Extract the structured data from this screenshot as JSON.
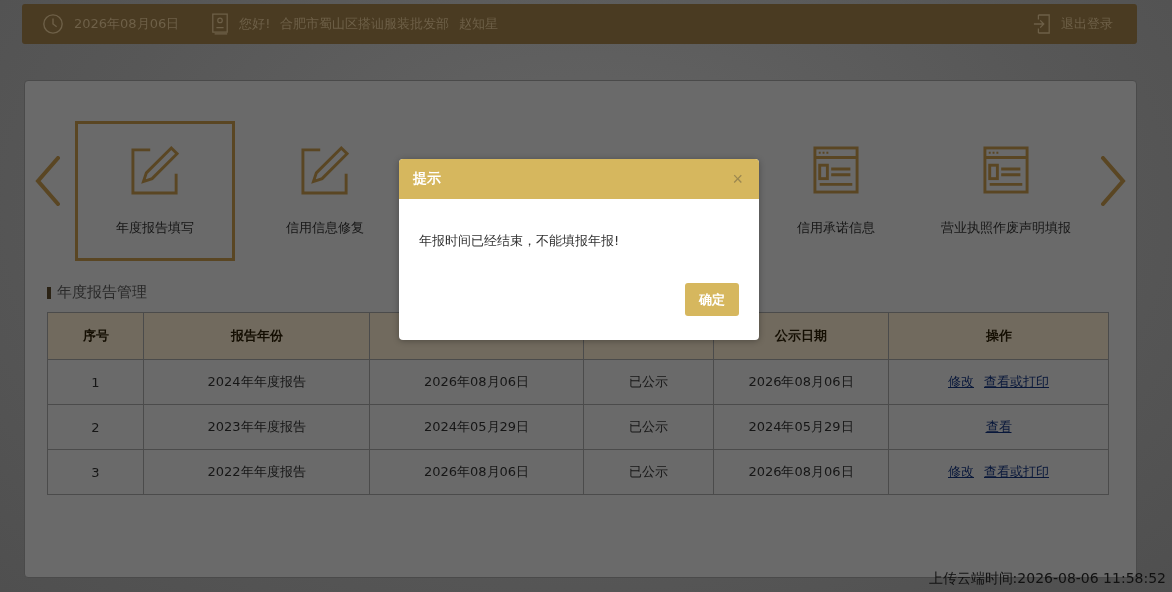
{
  "header": {
    "date": "2026年08月06日",
    "greeting": "您好!",
    "company": "合肥市蜀山区搭讪服装批发部",
    "user": "赵知星",
    "logout": "退出登录"
  },
  "nav": {
    "items": [
      {
        "label": "年度报告填写",
        "kind": "edit",
        "selected": true
      },
      {
        "label": "信用信息修复",
        "kind": "edit",
        "selected": false
      },
      {
        "label": "信用承诺信息",
        "kind": "form",
        "selected": false
      },
      {
        "label": "营业执照作废声明填报",
        "kind": "form",
        "selected": false
      }
    ]
  },
  "section_title": "年度报告管理",
  "table": {
    "columns": [
      {
        "header": "序号"
      },
      {
        "header": "报告年份"
      },
      {},
      {},
      {
        "header": "公示日期"
      },
      {
        "header": "操作"
      }
    ],
    "rows": [
      {
        "cells": [
          "1",
          "2024年年度报告",
          "2026年08月06日",
          "已公示",
          "2026年08月06日"
        ],
        "actions": [
          "修改",
          "查看或打印"
        ]
      },
      {
        "cells": [
          "2",
          "2023年年度报告",
          "2024年05月29日",
          "已公示",
          "2024年05月29日"
        ],
        "actions": [
          "查看"
        ]
      },
      {
        "cells": [
          "3",
          "2022年年度报告",
          "2026年08月06日",
          "已公示",
          "2026年08月06日"
        ],
        "actions": [
          "修改",
          "查看或打印"
        ]
      }
    ]
  },
  "upload_time": "上传云端时间:2026-08-06 11:58:52",
  "dialog": {
    "title": "提示",
    "close": "×",
    "message": "年报时间已经结束，不能填报年报!",
    "button": "确定"
  }
}
